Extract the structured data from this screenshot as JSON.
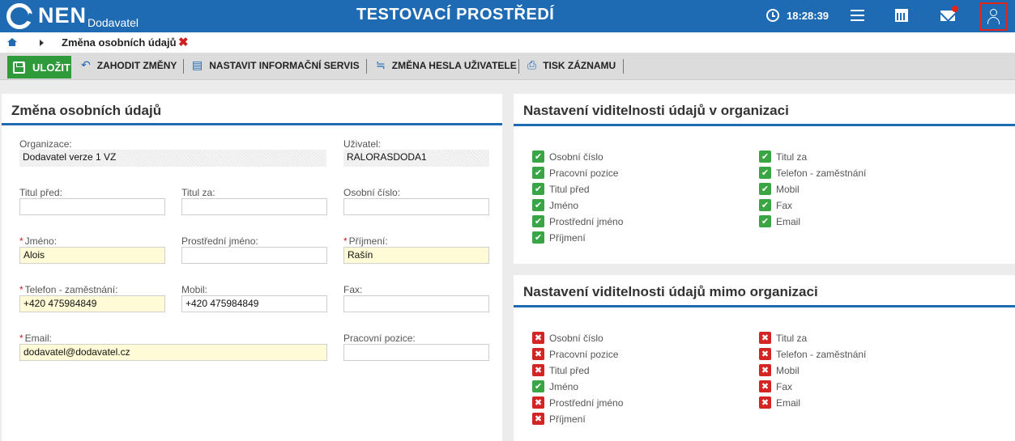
{
  "header": {
    "logo_text": "NEN",
    "logo_sub": "Dodavatel",
    "env_title": "TESTOVACÍ PROSTŘEDÍ",
    "time": "18:28:39"
  },
  "breadcrumb": {
    "title": "Změna osobních údajů",
    "close_glyph": "✖"
  },
  "toolbar": {
    "save": "ULOŽIT",
    "discard": "ZAHODIT ZMĚNY",
    "info_service": "NASTAVIT INFORMAČNÍ SERVIS",
    "change_password": "ZMĚNA HESLA UŽIVATELE",
    "print": "TISK ZÁZNAMU"
  },
  "form": {
    "title": "Změna osobních údajů",
    "organizace": {
      "label": "Organizace:",
      "value": "Dodavatel verze 1 VZ"
    },
    "uzivatel": {
      "label": "Uživatel:",
      "value": "RALORASDODA1"
    },
    "titul_pred": {
      "label": "Titul před:",
      "value": ""
    },
    "titul_za": {
      "label": "Titul za:",
      "value": ""
    },
    "osobni_cislo": {
      "label": "Osobní číslo:",
      "value": ""
    },
    "jmeno": {
      "label": "Jméno:",
      "value": "Alois"
    },
    "prostredni_jmeno": {
      "label": "Prostřední jméno:",
      "value": ""
    },
    "prijmeni": {
      "label": "Příjmení:",
      "value": "Rašín"
    },
    "telefon": {
      "label": "Telefon - zaměstnání:",
      "value": "+420 475984849"
    },
    "mobil": {
      "label": "Mobil:",
      "value": "+420 475984849"
    },
    "fax": {
      "label": "Fax:",
      "value": ""
    },
    "email": {
      "label": "Email:",
      "value": "dodavatel@dodavatel.cz"
    },
    "pracovni_pozice": {
      "label": "Pracovní pozice:",
      "value": ""
    },
    "required_mark": "*"
  },
  "visibility_in": {
    "title": "Nastavení viditelnosti údajů v organizaci",
    "items": [
      {
        "label": "Osobní číslo",
        "checked": true
      },
      {
        "label": "Pracovní pozice",
        "checked": true
      },
      {
        "label": "Titul před",
        "checked": true
      },
      {
        "label": "Jméno",
        "checked": true
      },
      {
        "label": "Prostřední jméno",
        "checked": true
      },
      {
        "label": "Příjmení",
        "checked": true
      },
      {
        "label": "Titul za",
        "checked": true
      },
      {
        "label": "Telefon - zaměstnání",
        "checked": true
      },
      {
        "label": "Mobil",
        "checked": true
      },
      {
        "label": "Fax",
        "checked": true
      },
      {
        "label": "Email",
        "checked": true
      }
    ]
  },
  "visibility_out": {
    "title": "Nastavení viditelnosti údajů mimo organizaci",
    "items": [
      {
        "label": "Osobní číslo",
        "checked": false
      },
      {
        "label": "Pracovní pozice",
        "checked": false
      },
      {
        "label": "Titul před",
        "checked": false
      },
      {
        "label": "Jméno",
        "checked": true
      },
      {
        "label": "Prostřední jméno",
        "checked": false
      },
      {
        "label": "Příjmení",
        "checked": false
      },
      {
        "label": "Titul za",
        "checked": false
      },
      {
        "label": "Telefon - zaměstnání",
        "checked": false
      },
      {
        "label": "Mobil",
        "checked": false
      },
      {
        "label": "Fax",
        "checked": false
      },
      {
        "label": "Email",
        "checked": false
      }
    ]
  },
  "glyphs": {
    "check": "✔",
    "cross": "✖"
  },
  "colors": {
    "brand": "#1f6bb3",
    "save": "#2e9a3a",
    "checked": "#3aa544",
    "unchecked": "#d42525",
    "required_bg": "#fffbd6"
  }
}
